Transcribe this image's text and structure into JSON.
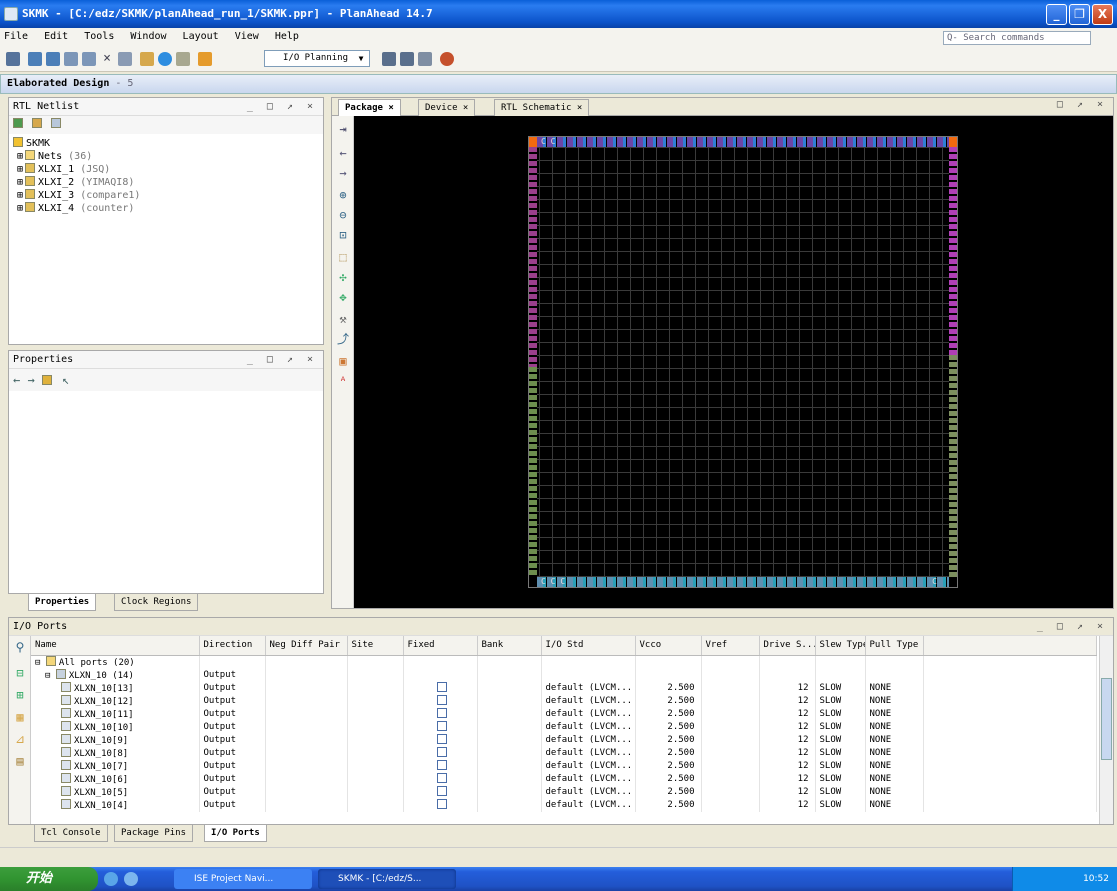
{
  "window": {
    "title": "SKMK - [C:/edz/SKMK/planAhead_run_1/SKMK.ppr] - PlanAhead 14.7",
    "minimize": "_",
    "maximize": "❐",
    "close": "X"
  },
  "menu": [
    "File",
    "Edit",
    "Tools",
    "Window",
    "Layout",
    "View",
    "Help"
  ],
  "search": {
    "placeholder": "Q- Search commands"
  },
  "toolbar": {
    "layout_select": "I/O Planning"
  },
  "design": {
    "title": "Elaborated Design",
    "suffix": "- 5"
  },
  "rtl_netlist": {
    "title": "RTL Netlist",
    "controls": "_ □ ↗ ×",
    "root": "SKMK",
    "items": [
      {
        "label": "Nets",
        "detail": "(36)"
      },
      {
        "label": "XLXI_1",
        "detail": "(JSQ)"
      },
      {
        "label": "XLXI_2",
        "detail": "(YIMAQI8)"
      },
      {
        "label": "XLXI_3",
        "detail": "(compare1)"
      },
      {
        "label": "XLXI_4",
        "detail": "(counter)"
      }
    ]
  },
  "properties": {
    "title": "Properties",
    "controls": "_ □ ↗ ×"
  },
  "left_tabs": {
    "properties": "Properties",
    "clock_regions": "Clock Regions"
  },
  "view_tabs": [
    "Package",
    "Device",
    "RTL Schematic"
  ],
  "view_controls": "□ ↗ ×",
  "pkg_labels": {
    "c1": "C",
    "c2": "C",
    "b1": "C",
    "b2": "C",
    "b3": "C",
    "b4": "C"
  },
  "io_ports": {
    "title": "I/O Ports",
    "controls": "_ □ ↗ ×",
    "columns": [
      "Name",
      "Direction",
      "Neg Diff Pair",
      "Site",
      "Fixed",
      "Bank",
      "I/O Std",
      "Vcco",
      "Vref",
      "Drive S...",
      "Slew Type",
      "Pull Type"
    ],
    "all_ports": "All ports (20)",
    "group": {
      "name": "XLXN_10 (14)",
      "direction": "Output"
    },
    "rows": [
      {
        "name": "XLXN_10[13]",
        "direction": "Output",
        "iostd": "default (LVCM...",
        "vcco": "2.500",
        "drive": "12",
        "slew": "SLOW",
        "pull": "NONE"
      },
      {
        "name": "XLXN_10[12]",
        "direction": "Output",
        "iostd": "default (LVCM...",
        "vcco": "2.500",
        "drive": "12",
        "slew": "SLOW",
        "pull": "NONE"
      },
      {
        "name": "XLXN_10[11]",
        "direction": "Output",
        "iostd": "default (LVCM...",
        "vcco": "2.500",
        "drive": "12",
        "slew": "SLOW",
        "pull": "NONE"
      },
      {
        "name": "XLXN_10[10]",
        "direction": "Output",
        "iostd": "default (LVCM...",
        "vcco": "2.500",
        "drive": "12",
        "slew": "SLOW",
        "pull": "NONE"
      },
      {
        "name": "XLXN_10[9]",
        "direction": "Output",
        "iostd": "default (LVCM...",
        "vcco": "2.500",
        "drive": "12",
        "slew": "SLOW",
        "pull": "NONE"
      },
      {
        "name": "XLXN_10[8]",
        "direction": "Output",
        "iostd": "default (LVCM...",
        "vcco": "2.500",
        "drive": "12",
        "slew": "SLOW",
        "pull": "NONE"
      },
      {
        "name": "XLXN_10[7]",
        "direction": "Output",
        "iostd": "default (LVCM...",
        "vcco": "2.500",
        "drive": "12",
        "slew": "SLOW",
        "pull": "NONE"
      },
      {
        "name": "XLXN_10[6]",
        "direction": "Output",
        "iostd": "default (LVCM...",
        "vcco": "2.500",
        "drive": "12",
        "slew": "SLOW",
        "pull": "NONE"
      },
      {
        "name": "XLXN_10[5]",
        "direction": "Output",
        "iostd": "default (LVCM...",
        "vcco": "2.500",
        "drive": "12",
        "slew": "SLOW",
        "pull": "NONE"
      },
      {
        "name": "XLXN_10[4]",
        "direction": "Output",
        "iostd": "default (LVCM...",
        "vcco": "2.500",
        "drive": "12",
        "slew": "SLOW",
        "pull": "NONE"
      }
    ]
  },
  "bottom_tabs": [
    "Tcl Console",
    "Package Pins",
    "I/O Ports"
  ],
  "taskbar": {
    "start": "开始",
    "buttons": [
      "ISE Project Navi...",
      "SKMK - [C:/edz/S..."
    ],
    "clock": "10:52"
  },
  "colors": {
    "title_blue": "#0b52c9",
    "accent_orange": "#f26a10",
    "start_green": "#319431"
  }
}
